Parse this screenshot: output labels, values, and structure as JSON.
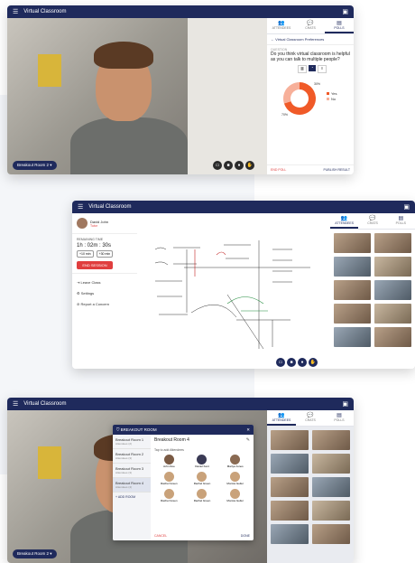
{
  "app_title": "Virtual Classroom",
  "win1": {
    "tabs": [
      "ATTENDEES",
      "CHATS",
      "POLLS"
    ],
    "breakout_label": "Breakout Room 2",
    "panel_back_title": "Virtual Classroom Preferences",
    "question_label": "QUESTION",
    "question": "Do you think virtual classroom is helpful as you can talk to multiple people?",
    "legend_yes": "Yes",
    "legend_no": "No",
    "pct_yes": "70%",
    "pct_no": "30%",
    "end_poll": "END POLL",
    "publish": "PUBLISH RESULT",
    "chart_data": {
      "type": "pie",
      "categories": [
        "Yes",
        "No"
      ],
      "values": [
        70,
        30
      ],
      "colors": [
        "#f05a28",
        "#f7b09a"
      ]
    }
  },
  "win2": {
    "user_name": "David John",
    "user_role": "Tutor",
    "remaining_label": "REMAINING TIME",
    "timer": "1h : 02m : 30s",
    "extend_buttons": [
      "+10 min",
      "+30 min"
    ],
    "end_button": "END SESSION",
    "menu": [
      "Leave Class",
      "Settings",
      "Report a Concern"
    ],
    "tabs": [
      "ATTENDEES",
      "CHATS",
      "POLLS"
    ]
  },
  "win3": {
    "dialog_title": "BREAKOUT ROOM",
    "rooms": [
      {
        "name": "Breakout Room 1",
        "count": "Attendees (2)"
      },
      {
        "name": "Breakout Room 2",
        "count": "Attendees (3)"
      },
      {
        "name": "Breakout Room 3",
        "count": "Attendees (3)"
      },
      {
        "name": "Breakout Room 4",
        "count": "Attendees (4)"
      }
    ],
    "add_room": "+ ADD ROOM",
    "room_title": "Breakout Room 4",
    "tap_hint": "Tap to add Attendees",
    "people": [
      "John Doe",
      "Daniel Kent",
      "Mariya Jones",
      "Rachel Green",
      "Rachel Green",
      "Monica Geller",
      "Rachel Green",
      "Rachel Green",
      "Monica Geller"
    ],
    "cancel": "CANCEL",
    "done": "DONE",
    "breakout_label": "Breakout Room 2",
    "tabs": [
      "ATTENDEES",
      "CHATS",
      "POLLS"
    ]
  }
}
